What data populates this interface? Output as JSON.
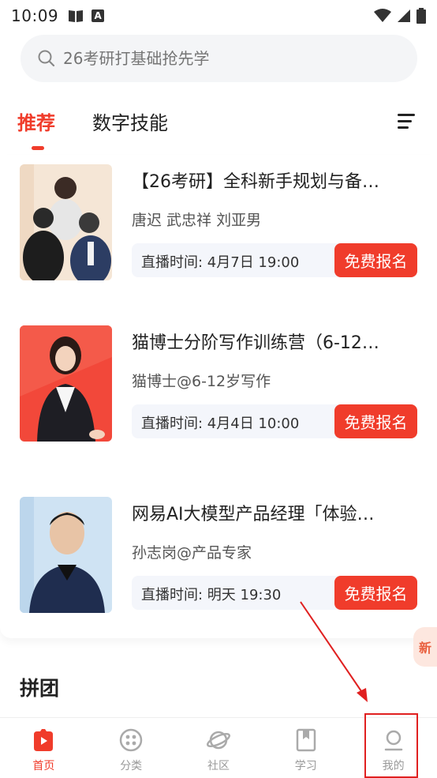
{
  "status_bar": {
    "time": "10:09",
    "app_badge": "A"
  },
  "search": {
    "placeholder": "26考研打基础抢先学"
  },
  "tabs": [
    {
      "label": "推荐",
      "active": true
    },
    {
      "label": "数字技能",
      "active": false
    }
  ],
  "courses": [
    {
      "title": "【26考研】全科新手规划与备…",
      "teachers": "唐迟 武忠祥 刘亚男",
      "live_time": "直播时间: 4月7日  19:00",
      "button": "免费报名"
    },
    {
      "title": "猫博士分阶写作训练营（6-12…",
      "teachers": "猫博士@6-12岁写作",
      "live_time": "直播时间: 4月4日  10:00",
      "button": "免费报名"
    },
    {
      "title": "网易AI大模型产品经理「体验…",
      "teachers": "孙志岗@产品专家",
      "live_time": "直播时间: 明天  19:30",
      "button": "免费报名"
    }
  ],
  "section_title": "拼团",
  "float_badge": "新",
  "bottom_nav": [
    {
      "label": "首页",
      "icon": "home-play-icon",
      "active": true
    },
    {
      "label": "分类",
      "icon": "category-icon",
      "active": false
    },
    {
      "label": "社区",
      "icon": "planet-icon",
      "active": false
    },
    {
      "label": "学习",
      "icon": "bookmark-icon",
      "active": false
    },
    {
      "label": "我的",
      "icon": "profile-icon",
      "active": false
    }
  ],
  "colors": {
    "accent": "#f03c2b",
    "annotation": "#e02020"
  }
}
